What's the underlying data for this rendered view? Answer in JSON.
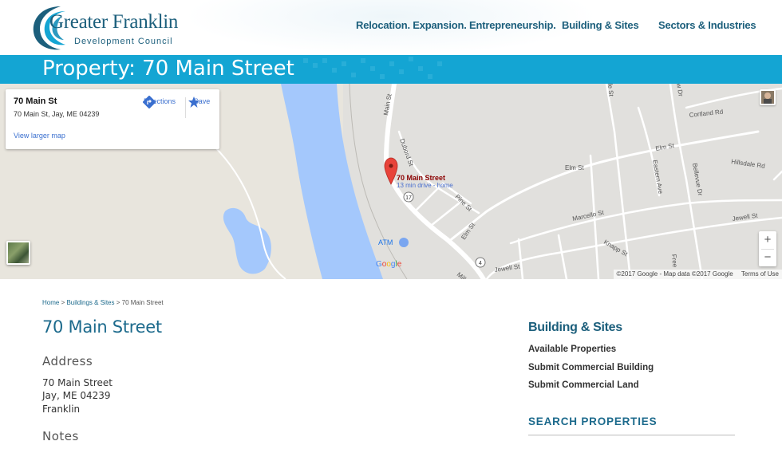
{
  "header": {
    "logo_line1": "Greater Franklin",
    "logo_line2": "Development Council",
    "nav": [
      {
        "label": "Relocation. Expansion. Entrepreneurship."
      },
      {
        "label": "Building & Sites"
      },
      {
        "label": "Sectors & Industries"
      }
    ]
  },
  "banner": {
    "title": "Property: 70 Main Street"
  },
  "map": {
    "card": {
      "title": "70 Main St",
      "address": "70 Main St, Jay, ME 04239",
      "directions_label": "Directions",
      "save_label": "Save",
      "larger_map_label": "View larger map"
    },
    "marker": {
      "label": "70 Main Street",
      "sublabel": "13 min drive - home"
    },
    "streets": [
      "Main St",
      "Dubord St",
      "Pine St",
      "Elm St",
      "Elm St",
      "Elm St",
      "Marcello St",
      "Knapp St",
      "Jewell St",
      "Jewell St",
      "Cortland Rd",
      "Hillsdale Rd",
      "Eastern Ave",
      "Bellevue Dr",
      "Mill",
      "Free",
      "le St",
      "w Dr"
    ],
    "route_badges": [
      "17",
      "4"
    ],
    "atm_label": "ATM",
    "google_label": "Google",
    "zoom_in": "+",
    "zoom_out": "−",
    "attribution": "©2017 Google - Map data ©2017 Google",
    "terms": "Terms of Use",
    "colors": {
      "land": "#e5e3df",
      "water": "#a4c8fc",
      "road": "#ffffff",
      "marker": "#e8433a"
    }
  },
  "breadcrumb": {
    "home": "Home",
    "sep1": " > ",
    "section": "Buildings & Sites",
    "sep2": " > ",
    "current": "70 Main Street"
  },
  "main": {
    "title": "70 Main Street",
    "address_heading": "Address",
    "address_lines": [
      "70 Main Street",
      "Jay, ME 04239",
      "Franklin"
    ],
    "notes_heading": "Notes"
  },
  "sidebar": {
    "title": "Building & Sites",
    "links": [
      "Available Properties",
      "Submit Commercial Building",
      "Submit Commercial Land"
    ],
    "search_title": "SEARCH PROPERTIES"
  },
  "colors": {
    "brand": "#1c5f7c",
    "banner": "#14a5d3",
    "link": "#3a6fcf"
  }
}
